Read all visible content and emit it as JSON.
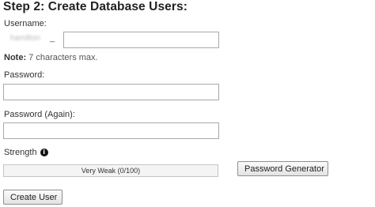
{
  "heading": "Step 2: Create Database Users:",
  "username": {
    "label": "Username:",
    "prefix": "hamilton",
    "separator": "_",
    "value": "",
    "placeholder": ""
  },
  "note": {
    "bold": "Note:",
    "text": " 7 characters max."
  },
  "password": {
    "label": "Password:",
    "value": ""
  },
  "password_again": {
    "label": "Password (Again):",
    "value": ""
  },
  "strength": {
    "label": "Strength",
    "info_icon": "info-icon",
    "text": "Very Weak (0/100)",
    "score": 0,
    "max": 100,
    "fill_color": "#d9534f"
  },
  "buttons": {
    "password_generator": "Password Generator",
    "create_user": "Create User"
  }
}
